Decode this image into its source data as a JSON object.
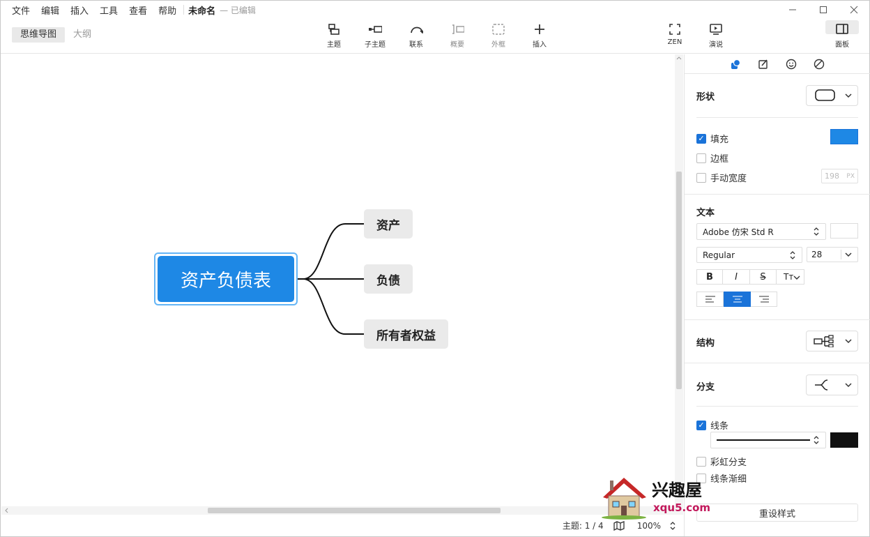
{
  "menu": [
    "文件",
    "编辑",
    "插入",
    "工具",
    "查看",
    "帮助"
  ],
  "document": {
    "title": "未命名",
    "status": "— 已编辑"
  },
  "view_tabs": {
    "mindmap": "思维导图",
    "outline": "大纲"
  },
  "toolbar": {
    "topic": "主题",
    "subtopic": "子主题",
    "relationship": "联系",
    "summary": "概要",
    "boundary": "外框",
    "insert": "插入",
    "zen": "ZEN",
    "present": "演说",
    "panel": "面板"
  },
  "mindmap": {
    "root": "资产负债表",
    "children": [
      "资产",
      "负债",
      "所有者权益"
    ]
  },
  "statusbar": {
    "topics": "主题: 1 / 4",
    "zoom": "100%"
  },
  "panel": {
    "shape_title": "形状",
    "fill_label": "填充",
    "fill_checked": true,
    "fill_color": "#1e88e5",
    "border_label": "边框",
    "border_checked": false,
    "manual_width_label": "手动宽度",
    "manual_width_checked": false,
    "width_value": "198",
    "width_unit": "PX",
    "text_title": "文本",
    "font_family": "Adobe 仿宋 Std R",
    "font_style": "Regular",
    "font_size": "28",
    "text_color": "#ffffff",
    "bold": "B",
    "italic": "I",
    "strike": "S",
    "case": "Tт",
    "structure_title": "结构",
    "branch_title": "分支",
    "line_label": "线条",
    "line_checked": true,
    "line_color": "#111111",
    "rainbow_label": "彩虹分支",
    "rainbow_checked": false,
    "taper_label": "线条渐细",
    "taper_checked": false,
    "reset_label": "重设样式"
  },
  "watermark": {
    "name": "兴趣屋",
    "site": "xqu5.com"
  }
}
